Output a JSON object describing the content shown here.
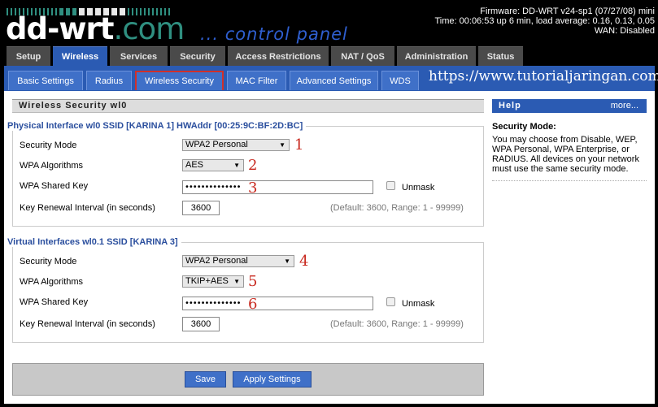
{
  "header": {
    "logo_main": "dd-wrt",
    "logo_dom": ".com",
    "subtitle": "... control panel",
    "firmware": "Firmware: DD-WRT v24-sp1 (07/27/08) mini",
    "time": "Time: 00:06:53 up 6 min, load average: 0.16, 0.13, 0.05",
    "wan": "WAN: Disabled"
  },
  "main_tabs": [
    "Setup",
    "Wireless",
    "Services",
    "Security",
    "Access Restrictions",
    "NAT / QoS",
    "Administration",
    "Status"
  ],
  "sub_tabs": [
    "Basic Settings",
    "Radius",
    "Wireless Security",
    "MAC Filter",
    "Advanced Settings",
    "WDS"
  ],
  "watermark": "https://www.tutorialjaringan.com",
  "page_title": "Wireless Security wl0",
  "physical": {
    "legend": "Physical Interface wl0 SSID [KARINA 1] HWAddr [00:25:9C:BF:2D:BC]",
    "security_mode_label": "Security Mode",
    "security_mode_value": "WPA2 Personal",
    "wpa_alg_label": "WPA Algorithms",
    "wpa_alg_value": "AES",
    "shared_key_label": "WPA Shared Key",
    "shared_key_value": "••••••••••••••",
    "unmask_label": "Unmask",
    "renewal_label": "Key Renewal Interval (in seconds)",
    "renewal_value": "3600",
    "renewal_hint": "(Default: 3600, Range: 1 - 99999)"
  },
  "virtual": {
    "legend": "Virtual Interfaces wl0.1 SSID [KARINA 3]",
    "security_mode_label": "Security Mode",
    "security_mode_value": "WPA2 Personal",
    "wpa_alg_label": "WPA Algorithms",
    "wpa_alg_value": "TKIP+AES",
    "shared_key_label": "WPA Shared Key",
    "shared_key_value": "••••••••••••••",
    "unmask_label": "Unmask",
    "renewal_label": "Key Renewal Interval (in seconds)",
    "renewal_value": "3600",
    "renewal_hint": "(Default: 3600, Range: 1 - 99999)"
  },
  "annotations": [
    "1",
    "2",
    "3",
    "4",
    "5",
    "6"
  ],
  "buttons": {
    "save": "Save",
    "apply": "Apply Settings"
  },
  "help": {
    "title": "Help",
    "more": "more...",
    "heading": "Security Mode:",
    "text": "You may choose from Disable, WEP, WPA Personal, WPA Enterprise, or RADIUS. All devices on your network must use the same security mode."
  },
  "colors": {
    "tab_active": "#2b5bb3",
    "tab_inactive": "#4a4a4a",
    "legend": "#2b4f9e",
    "annotation": "#c8281e",
    "accent_teal": "#2f8f80"
  }
}
